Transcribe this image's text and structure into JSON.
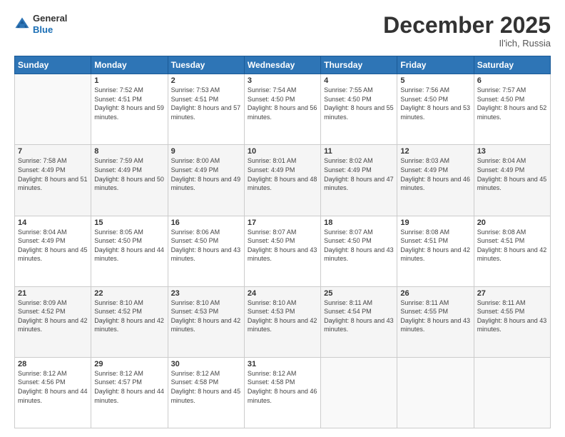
{
  "header": {
    "logo_general": "General",
    "logo_blue": "Blue",
    "month_title": "December 2025",
    "location": "Il'ich, Russia"
  },
  "weekdays": [
    "Sunday",
    "Monday",
    "Tuesday",
    "Wednesday",
    "Thursday",
    "Friday",
    "Saturday"
  ],
  "weeks": [
    [
      {
        "day": "",
        "sunrise": "",
        "sunset": "",
        "daylight": ""
      },
      {
        "day": "1",
        "sunrise": "Sunrise: 7:52 AM",
        "sunset": "Sunset: 4:51 PM",
        "daylight": "Daylight: 8 hours and 59 minutes."
      },
      {
        "day": "2",
        "sunrise": "Sunrise: 7:53 AM",
        "sunset": "Sunset: 4:51 PM",
        "daylight": "Daylight: 8 hours and 57 minutes."
      },
      {
        "day": "3",
        "sunrise": "Sunrise: 7:54 AM",
        "sunset": "Sunset: 4:50 PM",
        "daylight": "Daylight: 8 hours and 56 minutes."
      },
      {
        "day": "4",
        "sunrise": "Sunrise: 7:55 AM",
        "sunset": "Sunset: 4:50 PM",
        "daylight": "Daylight: 8 hours and 55 minutes."
      },
      {
        "day": "5",
        "sunrise": "Sunrise: 7:56 AM",
        "sunset": "Sunset: 4:50 PM",
        "daylight": "Daylight: 8 hours and 53 minutes."
      },
      {
        "day": "6",
        "sunrise": "Sunrise: 7:57 AM",
        "sunset": "Sunset: 4:50 PM",
        "daylight": "Daylight: 8 hours and 52 minutes."
      }
    ],
    [
      {
        "day": "7",
        "sunrise": "Sunrise: 7:58 AM",
        "sunset": "Sunset: 4:49 PM",
        "daylight": "Daylight: 8 hours and 51 minutes."
      },
      {
        "day": "8",
        "sunrise": "Sunrise: 7:59 AM",
        "sunset": "Sunset: 4:49 PM",
        "daylight": "Daylight: 8 hours and 50 minutes."
      },
      {
        "day": "9",
        "sunrise": "Sunrise: 8:00 AM",
        "sunset": "Sunset: 4:49 PM",
        "daylight": "Daylight: 8 hours and 49 minutes."
      },
      {
        "day": "10",
        "sunrise": "Sunrise: 8:01 AM",
        "sunset": "Sunset: 4:49 PM",
        "daylight": "Daylight: 8 hours and 48 minutes."
      },
      {
        "day": "11",
        "sunrise": "Sunrise: 8:02 AM",
        "sunset": "Sunset: 4:49 PM",
        "daylight": "Daylight: 8 hours and 47 minutes."
      },
      {
        "day": "12",
        "sunrise": "Sunrise: 8:03 AM",
        "sunset": "Sunset: 4:49 PM",
        "daylight": "Daylight: 8 hours and 46 minutes."
      },
      {
        "day": "13",
        "sunrise": "Sunrise: 8:04 AM",
        "sunset": "Sunset: 4:49 PM",
        "daylight": "Daylight: 8 hours and 45 minutes."
      }
    ],
    [
      {
        "day": "14",
        "sunrise": "Sunrise: 8:04 AM",
        "sunset": "Sunset: 4:49 PM",
        "daylight": "Daylight: 8 hours and 45 minutes."
      },
      {
        "day": "15",
        "sunrise": "Sunrise: 8:05 AM",
        "sunset": "Sunset: 4:50 PM",
        "daylight": "Daylight: 8 hours and 44 minutes."
      },
      {
        "day": "16",
        "sunrise": "Sunrise: 8:06 AM",
        "sunset": "Sunset: 4:50 PM",
        "daylight": "Daylight: 8 hours and 43 minutes."
      },
      {
        "day": "17",
        "sunrise": "Sunrise: 8:07 AM",
        "sunset": "Sunset: 4:50 PM",
        "daylight": "Daylight: 8 hours and 43 minutes."
      },
      {
        "day": "18",
        "sunrise": "Sunrise: 8:07 AM",
        "sunset": "Sunset: 4:50 PM",
        "daylight": "Daylight: 8 hours and 43 minutes."
      },
      {
        "day": "19",
        "sunrise": "Sunrise: 8:08 AM",
        "sunset": "Sunset: 4:51 PM",
        "daylight": "Daylight: 8 hours and 42 minutes."
      },
      {
        "day": "20",
        "sunrise": "Sunrise: 8:08 AM",
        "sunset": "Sunset: 4:51 PM",
        "daylight": "Daylight: 8 hours and 42 minutes."
      }
    ],
    [
      {
        "day": "21",
        "sunrise": "Sunrise: 8:09 AM",
        "sunset": "Sunset: 4:52 PM",
        "daylight": "Daylight: 8 hours and 42 minutes."
      },
      {
        "day": "22",
        "sunrise": "Sunrise: 8:10 AM",
        "sunset": "Sunset: 4:52 PM",
        "daylight": "Daylight: 8 hours and 42 minutes."
      },
      {
        "day": "23",
        "sunrise": "Sunrise: 8:10 AM",
        "sunset": "Sunset: 4:53 PM",
        "daylight": "Daylight: 8 hours and 42 minutes."
      },
      {
        "day": "24",
        "sunrise": "Sunrise: 8:10 AM",
        "sunset": "Sunset: 4:53 PM",
        "daylight": "Daylight: 8 hours and 42 minutes."
      },
      {
        "day": "25",
        "sunrise": "Sunrise: 8:11 AM",
        "sunset": "Sunset: 4:54 PM",
        "daylight": "Daylight: 8 hours and 43 minutes."
      },
      {
        "day": "26",
        "sunrise": "Sunrise: 8:11 AM",
        "sunset": "Sunset: 4:55 PM",
        "daylight": "Daylight: 8 hours and 43 minutes."
      },
      {
        "day": "27",
        "sunrise": "Sunrise: 8:11 AM",
        "sunset": "Sunset: 4:55 PM",
        "daylight": "Daylight: 8 hours and 43 minutes."
      }
    ],
    [
      {
        "day": "28",
        "sunrise": "Sunrise: 8:12 AM",
        "sunset": "Sunset: 4:56 PM",
        "daylight": "Daylight: 8 hours and 44 minutes."
      },
      {
        "day": "29",
        "sunrise": "Sunrise: 8:12 AM",
        "sunset": "Sunset: 4:57 PM",
        "daylight": "Daylight: 8 hours and 44 minutes."
      },
      {
        "day": "30",
        "sunrise": "Sunrise: 8:12 AM",
        "sunset": "Sunset: 4:58 PM",
        "daylight": "Daylight: 8 hours and 45 minutes."
      },
      {
        "day": "31",
        "sunrise": "Sunrise: 8:12 AM",
        "sunset": "Sunset: 4:58 PM",
        "daylight": "Daylight: 8 hours and 46 minutes."
      },
      {
        "day": "",
        "sunrise": "",
        "sunset": "",
        "daylight": ""
      },
      {
        "day": "",
        "sunrise": "",
        "sunset": "",
        "daylight": ""
      },
      {
        "day": "",
        "sunrise": "",
        "sunset": "",
        "daylight": ""
      }
    ]
  ]
}
